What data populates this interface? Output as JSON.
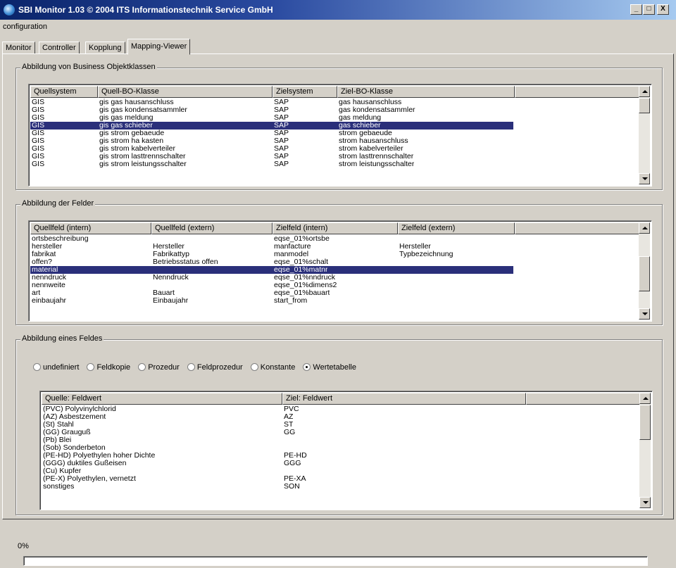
{
  "window": {
    "title": "SBI Monitor 1.03 © 2004 ITS Informationstechnik Service GmbH",
    "min_label": "_",
    "max_label": "□",
    "close_label": "X"
  },
  "menu": {
    "configuration": "configuration"
  },
  "tabs": [
    {
      "label": "Monitor",
      "active": false
    },
    {
      "label": "Controller",
      "active": false
    },
    {
      "label": "Kopplung",
      "active": false
    },
    {
      "label": "Mapping-Viewer",
      "active": true
    }
  ],
  "group1": {
    "legend": "Abbildung von Business Objektklassen",
    "columns": [
      "Quellsystem",
      "Quell-BO-Klasse",
      "Zielsystem",
      "Ziel-BO-Klasse"
    ],
    "rows": [
      [
        "GIS",
        "gis gas hausanschluss",
        "SAP",
        "gas hausanschluss"
      ],
      [
        "GIS",
        "gis gas kondensatsammler",
        "SAP",
        "gas kondensatsammler"
      ],
      [
        "GIS",
        "gis gas meldung",
        "SAP",
        "gas meldung"
      ],
      [
        "GIS",
        "gis gas schieber",
        "SAP",
        "gas schieber"
      ],
      [
        "GIS",
        "gis strom gebaeude",
        "SAP",
        "strom gebaeude"
      ],
      [
        "GIS",
        "gis strom ha kasten",
        "SAP",
        "strom hausanschluss"
      ],
      [
        "GIS",
        "gis strom kabelverteiler",
        "SAP",
        "strom kabelverteiler"
      ],
      [
        "GIS",
        "gis strom lasttrennschalter",
        "SAP",
        "strom lasttrennschalter"
      ],
      [
        "GIS",
        "gis strom leistungsschalter",
        "SAP",
        "strom leistungsschalter"
      ]
    ],
    "selected": 3
  },
  "group2": {
    "legend": "Abbildung der Felder",
    "columns": [
      "Quellfeld (intern)",
      "Quellfeld (extern)",
      "Zielfeld (intern)",
      "Zielfeld (extern)"
    ],
    "rows": [
      [
        "ortsbeschreibung",
        "",
        "eqse_01%ortsbe",
        ""
      ],
      [
        "hersteller",
        "Hersteller",
        "manfacture",
        "Hersteller"
      ],
      [
        "fabrikat",
        "Fabrikattyp",
        "manmodel",
        "Typbezeichnung"
      ],
      [
        "offen?",
        "Betriebsstatus offen",
        "eqse_01%schalt",
        ""
      ],
      [
        "material",
        "",
        "eqse_01%matnr",
        ""
      ],
      [
        "nenndruck",
        "Nenndruck",
        "eqse_01%nndruck",
        ""
      ],
      [
        "nennweite",
        "",
        "eqse_01%dimens2",
        ""
      ],
      [
        "art",
        "Bauart",
        "eqse_01%bauart",
        ""
      ],
      [
        "einbaujahr",
        "Einbaujahr",
        "start_from",
        ""
      ]
    ],
    "selected": 4
  },
  "group3": {
    "legend": "Abbildung eines Feldes",
    "radios": [
      {
        "label": "undefiniert",
        "checked": false
      },
      {
        "label": "Feldkopie",
        "checked": false
      },
      {
        "label": "Prozedur",
        "checked": false
      },
      {
        "label": "Feldprozedur",
        "checked": false
      },
      {
        "label": "Konstante",
        "checked": false
      },
      {
        "label": "Wertetabelle",
        "checked": true
      }
    ],
    "columns": [
      "Quelle: Feldwert",
      "Ziel: Feldwert"
    ],
    "rows": [
      [
        "(PVC) Polyvinylchlorid",
        "PVC"
      ],
      [
        "(AZ) Asbestzement",
        "AZ"
      ],
      [
        "(St) Stahl",
        "ST"
      ],
      [
        "(GG) Grauguß",
        "GG"
      ],
      [
        "(Pb) Blei",
        ""
      ],
      [
        "(Sob) Sonderbeton",
        ""
      ],
      [
        "(PE-HD) Polyethylen hoher Dichte",
        "PE-HD"
      ],
      [
        "(GGG) duktiles Gußeisen",
        "GGG"
      ],
      [
        "(Cu) Kupfer",
        ""
      ],
      [
        "(PE-X) Polyethylen, vernetzt",
        "PE-XA"
      ],
      [
        "sonstiges",
        "SON"
      ]
    ]
  },
  "status": {
    "percent_label": "0%",
    "progress": 0
  }
}
